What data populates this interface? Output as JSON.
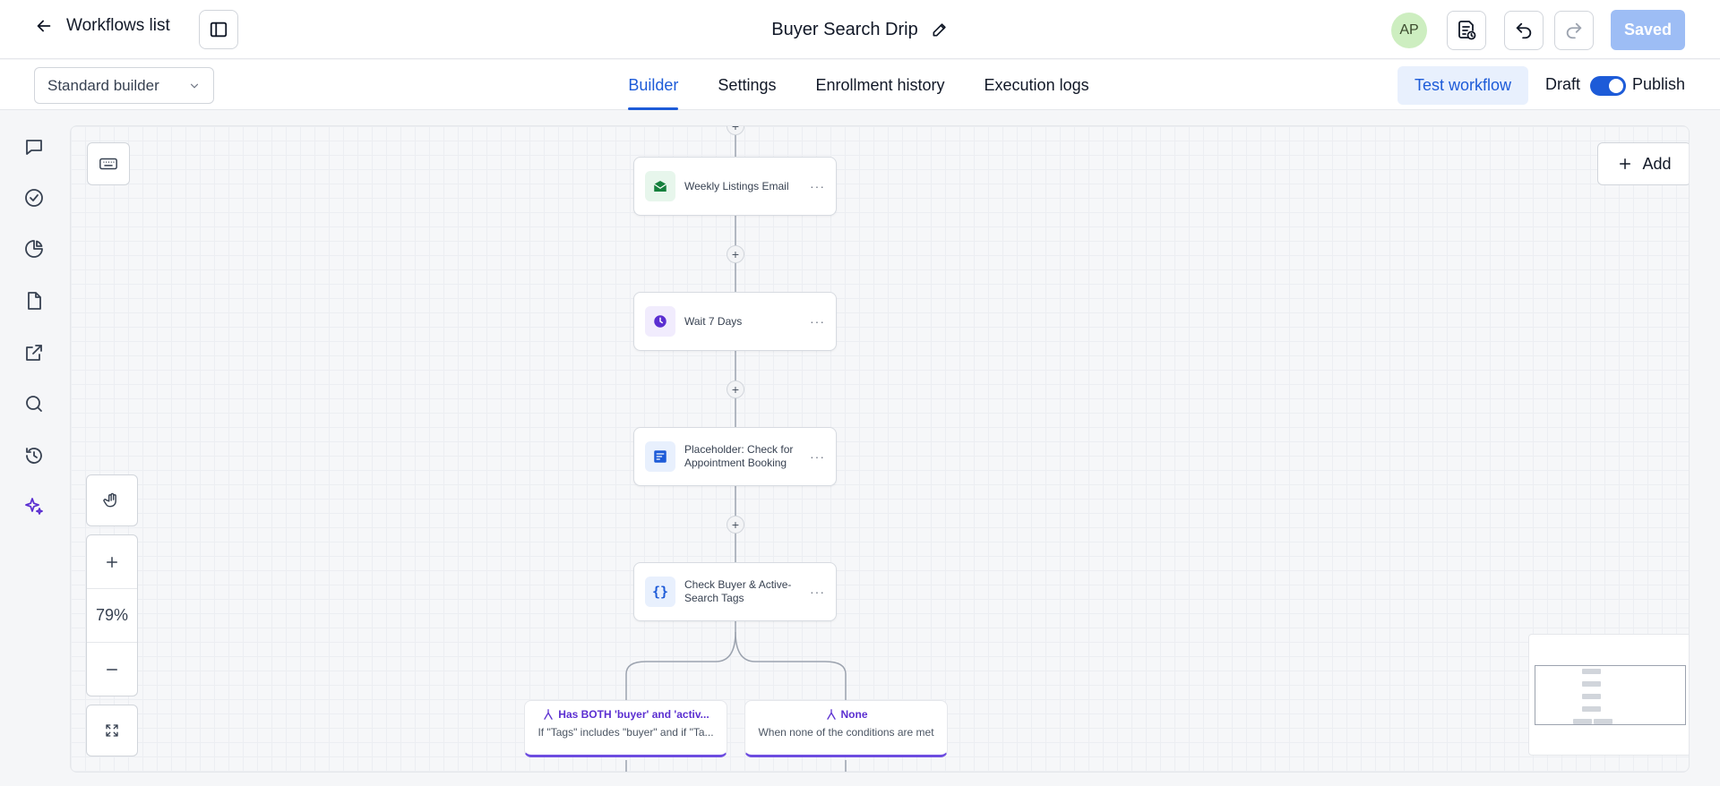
{
  "header": {
    "back_label": "Workflows list",
    "workflow_title": "Buyer Search Drip",
    "avatar_initials": "AP",
    "saved_label": "Saved"
  },
  "subbar": {
    "builder_select": "Standard builder",
    "tabs": [
      {
        "label": "Builder",
        "active": true
      },
      {
        "label": "Settings",
        "active": false
      },
      {
        "label": "Enrollment history",
        "active": false
      },
      {
        "label": "Execution logs",
        "active": false
      }
    ],
    "test_workflow_label": "Test workflow",
    "draft_label": "Draft",
    "publish_label": "Publish",
    "publish_toggle_on": true
  },
  "canvas": {
    "add_label": "Add",
    "zoom_level": "79%",
    "nodes": [
      {
        "label": "Weekly Listings Email",
        "icon": "email-icon",
        "icon_bg": "#e7f6ec",
        "icon_color": "#15803d"
      },
      {
        "label": "Wait 7 Days",
        "icon": "clock-icon",
        "icon_bg": "#f1ecfd",
        "icon_color": "#5b2fd1"
      },
      {
        "label": "Placeholder: Check for Appointment Booking",
        "icon": "note-icon",
        "icon_bg": "#e8f0fd",
        "icon_color": "#1d5bd8"
      },
      {
        "label": "Check Buyer & Active-Search Tags",
        "icon": "braces-icon",
        "icon_bg": "#e8f0fd",
        "icon_color": "#1d5bd8"
      }
    ],
    "branches": [
      {
        "title": "Has BOTH 'buyer' and 'activ...",
        "desc": "If \"Tags\" includes \"buyer\" and if \"Ta..."
      },
      {
        "title": "None",
        "desc": "When none of the conditions are met"
      }
    ]
  },
  "colors": {
    "primary": "#1d5bd8",
    "branch_accent": "#6d4ce0",
    "saved_disabled": "#9dbdf5"
  }
}
